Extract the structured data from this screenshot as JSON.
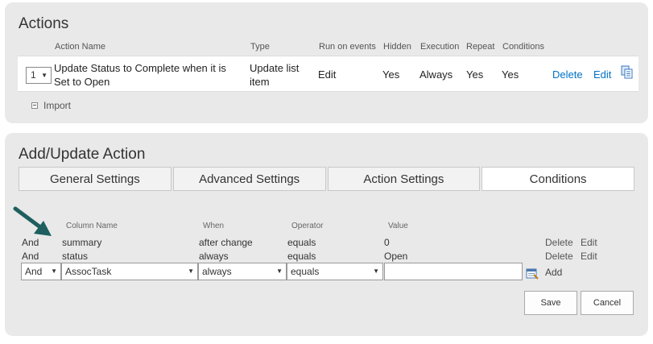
{
  "actions_panel": {
    "title": "Actions",
    "headers": {
      "action_name": "Action Name",
      "type": "Type",
      "run_on_events": "Run on events",
      "hidden": "Hidden",
      "execution": "Execution",
      "repeat": "Repeat",
      "conditions": "Conditions"
    },
    "row": {
      "order": "1",
      "name_line1": "Update Status to Complete when it is",
      "name_line2": "Set to Open",
      "type_line1": "Update list",
      "type_line2": "item",
      "run_on_events": "Edit",
      "hidden": "Yes",
      "execution": "Always",
      "repeat": "Yes",
      "conditions": "Yes",
      "delete_label": "Delete",
      "edit_label": "Edit"
    },
    "import_label": "Import"
  },
  "update_panel": {
    "title": "Add/Update Action",
    "tabs": [
      {
        "label": "General Settings",
        "active": false
      },
      {
        "label": "Advanced Settings",
        "active": false
      },
      {
        "label": "Action Settings",
        "active": false
      },
      {
        "label": "Conditions",
        "active": true
      }
    ],
    "headers": {
      "column_name": "Column Name",
      "when": "When",
      "operator": "Operator",
      "value": "Value"
    },
    "conditions": [
      {
        "join": "And",
        "column": "summary",
        "when": "after change",
        "operator": "equals",
        "value": "0",
        "delete": "Delete",
        "edit": "Edit"
      },
      {
        "join": "And",
        "column": "status",
        "when": "always",
        "operator": "equals",
        "value": "Open",
        "delete": "Delete",
        "edit": "Edit"
      }
    ],
    "new_condition": {
      "join": "And",
      "column": "AssocTask",
      "when": "always",
      "operator": "equals",
      "value": "",
      "add_label": "Add"
    },
    "save_label": "Save",
    "cancel_label": "Cancel"
  },
  "colors": {
    "panel_bg": "#e9e9e9",
    "link": "#0072c6",
    "arrow": "#1f5f5f"
  }
}
